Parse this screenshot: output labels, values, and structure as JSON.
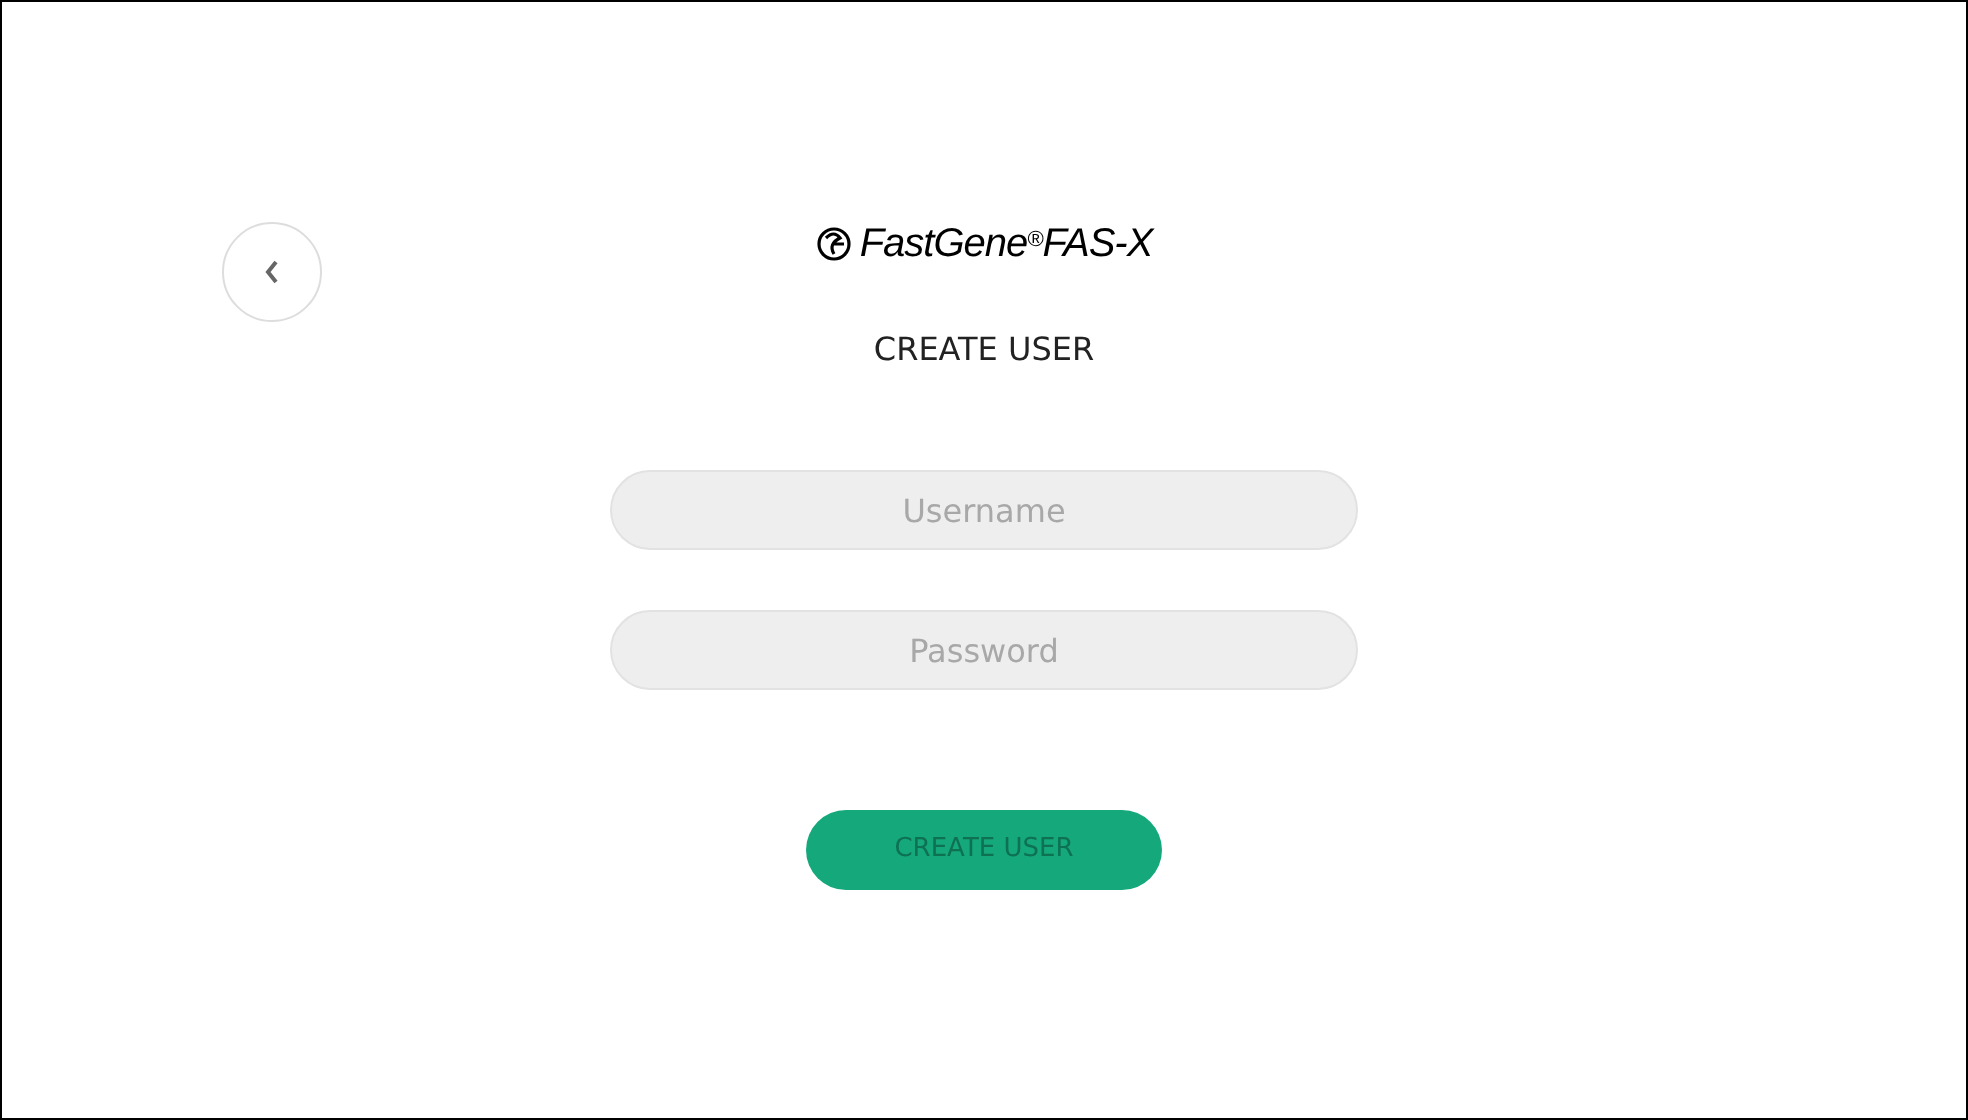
{
  "logo": {
    "brand": "FastGene",
    "mark": "®",
    "product": "FAS-X"
  },
  "title": "CREATE USER",
  "fields": [
    {
      "placeholder": "Username"
    },
    {
      "placeholder": "Password"
    }
  ],
  "submit": "CREATE USER"
}
